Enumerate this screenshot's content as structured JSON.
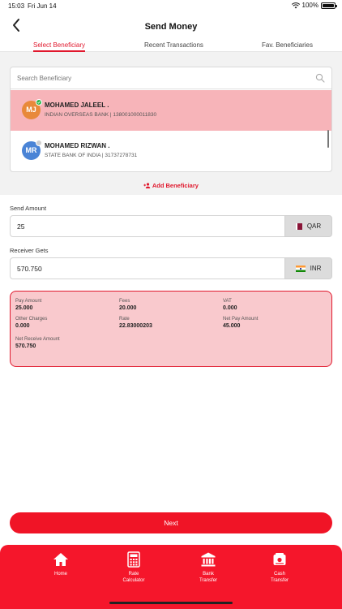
{
  "status_bar": {
    "time": "15:03",
    "date": "Fri Jun 14",
    "battery": "100%"
  },
  "header": {
    "title": "Send Money"
  },
  "tabs": [
    {
      "label": "Select Beneficiary",
      "active": true
    },
    {
      "label": "Recent Transactions",
      "active": false
    },
    {
      "label": "Fav. Beneficiaries",
      "active": false
    }
  ],
  "search": {
    "placeholder": "Search Beneficiary"
  },
  "beneficiaries": [
    {
      "initials": "MJ",
      "name": "MOHAMED JALEEL .",
      "detail": "INDIAN OVERSEAS BANK | 138001000011830",
      "selected": true,
      "avatar_color": "#e8893a"
    },
    {
      "initials": "MR",
      "name": "MOHAMED RIZWAN .",
      "detail": "STATE BANK OF INDIA | 31737278731",
      "selected": false,
      "avatar_color": "#4a84d6"
    }
  ],
  "add_beneficiary_label": "Add Beneficiary",
  "send_amount": {
    "label": "Send Amount",
    "value": "25",
    "currency": "QAR"
  },
  "receiver_gets": {
    "label": "Receiver Gets",
    "value": "570.750",
    "currency": "INR"
  },
  "summary": {
    "pay_amount": {
      "label": "Pay Amount",
      "value": "25.000"
    },
    "fees": {
      "label": "Fees",
      "value": "20.000"
    },
    "vat": {
      "label": "VAT",
      "value": "0.000"
    },
    "other_charges": {
      "label": "Other Charges",
      "value": "0.000"
    },
    "rate": {
      "label": "Rate",
      "value": "22.83000203"
    },
    "net_pay_amount": {
      "label": "Net Pay Amount",
      "value": "45.000"
    },
    "net_receive_amount": {
      "label": "Net Receive Amount",
      "value": "570.750"
    }
  },
  "next_label": "Next",
  "bottom_nav": [
    {
      "label": "Home",
      "icon": "home-icon"
    },
    {
      "label": "Rate\nCalculator",
      "icon": "calculator-icon"
    },
    {
      "label": "Bank\nTransfer",
      "icon": "bank-icon"
    },
    {
      "label": "Cash\nTransfer",
      "icon": "cash-icon"
    }
  ],
  "colors": {
    "accent": "#f01426",
    "selected_row": "#f7b4b9",
    "summary_bg": "#f9c9cd"
  }
}
